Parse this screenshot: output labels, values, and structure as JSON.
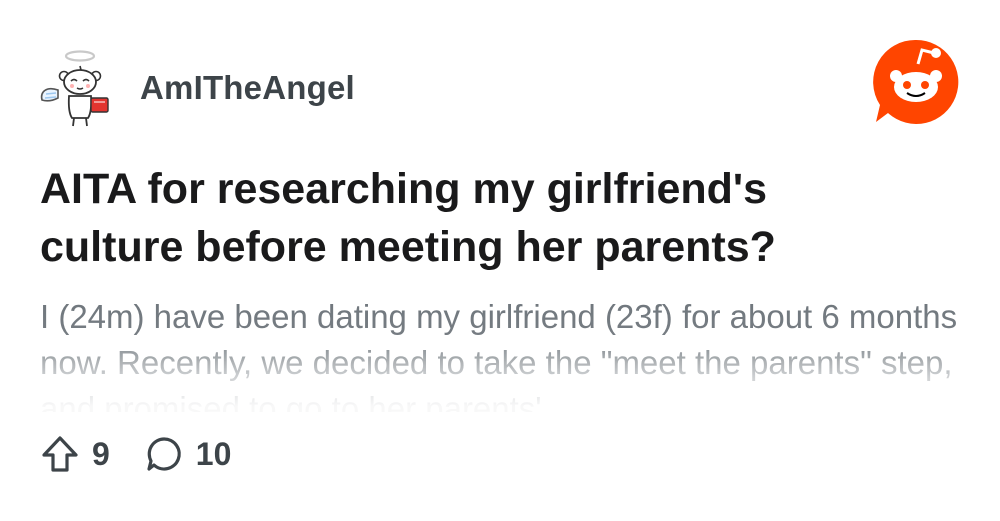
{
  "post": {
    "username": "AmITheAngel",
    "title": "AITA for researching my girlfriend's culture before meeting her parents?",
    "excerpt": "I (24m) have been dating my girlfriend (23f) for about 6 months now. Recently, we decided to take the \"meet the parents\" step, and promised to go to her parents'",
    "upvotes": "9",
    "comments": "10"
  },
  "icons": {
    "avatar": "angel-snoo-avatar",
    "brand": "reddit-logo-icon",
    "upvote": "upvote-arrow-icon",
    "comment": "comment-bubble-icon"
  },
  "colors": {
    "brand_orange": "#FF4500",
    "title_text": "#1A1A1B",
    "excerpt_text": "#6F767C",
    "meta_text": "#3D4449"
  }
}
